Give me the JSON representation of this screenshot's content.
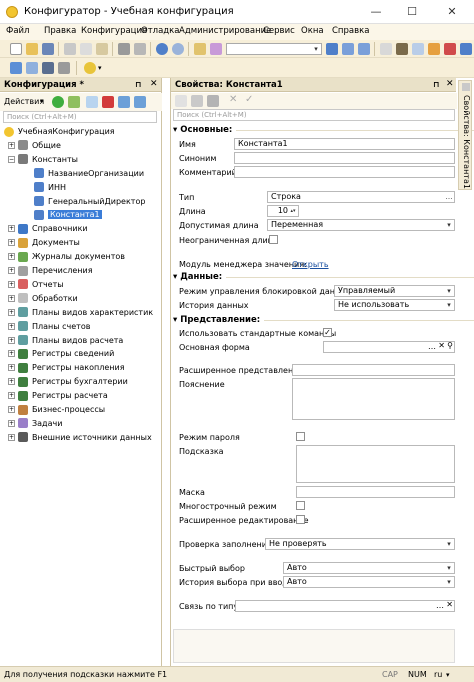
{
  "window": {
    "title": "Конфигуратор - Учебная конфигурация",
    "min": "—",
    "max": "☐",
    "close": "✕"
  },
  "menu": [
    "Файл",
    "Правка",
    "Конфигурация",
    "Отладка",
    "Администрирование",
    "Сервис",
    "Окна",
    "Справка"
  ],
  "left_panel": {
    "title": "Конфигурация *",
    "actions_label": "Действия",
    "search_placeholder": "Поиск (Ctrl+Alt+M)",
    "tree": [
      {
        "label": "УчебнаяКонфигурация",
        "level": 0,
        "icon": "config"
      },
      {
        "label": "Общие",
        "level": 1,
        "icon": "common"
      },
      {
        "label": "Константы",
        "level": 1,
        "icon": "constants"
      },
      {
        "label": "НазваниеОрганизации",
        "level": 2,
        "icon": "constant"
      },
      {
        "label": "ИНН",
        "level": 2,
        "icon": "constant"
      },
      {
        "label": "ГенеральныйДиректор",
        "level": 2,
        "icon": "constant"
      },
      {
        "label": "Константа1",
        "level": 2,
        "icon": "constant",
        "selected": true
      },
      {
        "label": "Справочники",
        "level": 1,
        "icon": "catalogs"
      },
      {
        "label": "Документы",
        "level": 1,
        "icon": "documents"
      },
      {
        "label": "Журналы документов",
        "level": 1,
        "icon": "journals"
      },
      {
        "label": "Перечисления",
        "level": 1,
        "icon": "enums"
      },
      {
        "label": "Отчеты",
        "level": 1,
        "icon": "reports"
      },
      {
        "label": "Обработки",
        "level": 1,
        "icon": "processing"
      },
      {
        "label": "Планы видов характеристик",
        "level": 1,
        "icon": "plan"
      },
      {
        "label": "Планы счетов",
        "level": 1,
        "icon": "plan"
      },
      {
        "label": "Планы видов расчета",
        "level": 1,
        "icon": "plan"
      },
      {
        "label": "Регистры сведений",
        "level": 1,
        "icon": "register"
      },
      {
        "label": "Регистры накопления",
        "level": 1,
        "icon": "register"
      },
      {
        "label": "Регистры бухгалтерии",
        "level": 1,
        "icon": "register"
      },
      {
        "label": "Регистры расчета",
        "level": 1,
        "icon": "register"
      },
      {
        "label": "Бизнес-процессы",
        "level": 1,
        "icon": "bp"
      },
      {
        "label": "Задачи",
        "level": 1,
        "icon": "tasks"
      },
      {
        "label": "Внешние источники данных",
        "level": 1,
        "icon": "ext"
      }
    ]
  },
  "properties": {
    "title": "Свойства: Константа1",
    "search_placeholder": "Поиск (Ctrl+Alt+M)",
    "side_tab": "Свойства: Константа1",
    "sections": {
      "main": "Основные:",
      "data": "Данные:",
      "presentation": "Представление:"
    },
    "fields": {
      "name_label": "Имя",
      "name_value": "Константа1",
      "synonym_label": "Синоним",
      "synonym_value": "",
      "comment_label": "Комментарий",
      "comment_value": "",
      "type_label": "Тип",
      "type_value": "Строка",
      "length_label": "Длина",
      "length_value": "10",
      "allowed_length_label": "Допустимая длина",
      "allowed_length_value": "Переменная",
      "unlimited_length_label": "Неограниченная длина",
      "manager_module_label": "Модуль менеджера значения:",
      "manager_module_link": "Открыть",
      "lock_mode_label": "Режим управления блокировкой данных",
      "lock_mode_value": "Управляемый",
      "data_history_label": "История данных",
      "data_history_value": "Не использовать",
      "use_std_commands_label": "Использовать стандартные команды",
      "main_form_label": "Основная форма",
      "main_form_value": "",
      "ext_presentation_label": "Расширенное представление",
      "explanation_label": "Пояснение",
      "password_mode_label": "Режим пароля",
      "tooltip_label": "Подсказка",
      "mask_label": "Маска",
      "multiline_label": "Многострочный режим",
      "ext_edit_label": "Расширенное редактирование",
      "fill_check_label": "Проверка заполнения",
      "fill_check_value": "Не проверять",
      "quick_choice_label": "Быстрый выбор",
      "quick_choice_value": "Авто",
      "input_history_label": "История выбора при вводе",
      "input_history_value": "Авто",
      "link_by_type_label": "Связь по типу",
      "link_by_type_value": ""
    }
  },
  "statusbar": {
    "hint": "Для получения подсказки нажмите F1",
    "cap": "CAP",
    "num": "NUM",
    "lang": "ru"
  },
  "colors": {
    "accent_header": "#e9e1c8",
    "toolbar": "#f7efd9",
    "selection": "#3b7dd8"
  }
}
